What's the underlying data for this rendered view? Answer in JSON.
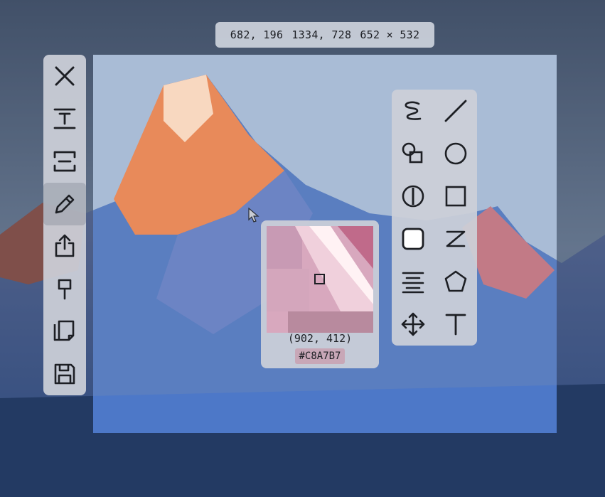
{
  "screen": {
    "kind": "screenshot region selection over mountain wallpaper"
  },
  "selection_info": {
    "start": "682, 196",
    "end": "1334, 728",
    "size": "652 × 532"
  },
  "toolbar": {
    "items": [
      {
        "name": "close",
        "icon": "close-icon"
      },
      {
        "name": "text-height",
        "icon": "text-height-icon"
      },
      {
        "name": "scroll-capture",
        "icon": "scroll-capture-icon"
      },
      {
        "name": "pen",
        "icon": "pencil-icon",
        "active": true
      },
      {
        "name": "share",
        "icon": "share-icon"
      },
      {
        "name": "pin",
        "icon": "pin-icon"
      },
      {
        "name": "copy",
        "icon": "copy-icon"
      },
      {
        "name": "save",
        "icon": "save-icon"
      }
    ]
  },
  "shapes_panel": {
    "items": [
      "freehand",
      "line",
      "shapes",
      "circle",
      "highlight",
      "rectangle",
      "filled-rectangle",
      "zigzag",
      "text-align",
      "polygon",
      "move",
      "text"
    ]
  },
  "magnifier": {
    "coordinate": "(902, 412)",
    "hex": "#C8A7B7",
    "color": "#C8A7B7"
  },
  "colors": {
    "panel": "#CCD0D8",
    "icon": "#1D1F24"
  }
}
